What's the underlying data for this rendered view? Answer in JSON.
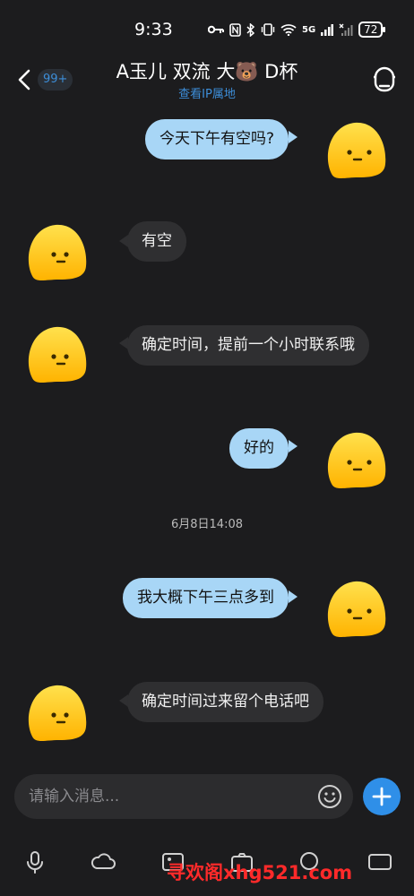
{
  "status_bar": {
    "time": "9:33",
    "network": "5G",
    "battery": "72"
  },
  "header": {
    "unread_count": "99+",
    "title": "A玉儿 双流 大🐻 D杯",
    "subtitle": "查看IP属地"
  },
  "messages": [
    {
      "side": "me",
      "text": "今天下午有空吗?"
    },
    {
      "side": "them",
      "text": "有空"
    },
    {
      "side": "them",
      "text": "确定时间，提前一个小时联系哦"
    },
    {
      "side": "me",
      "text": "好的"
    },
    {
      "side": "me",
      "text": "我大概下午三点多到"
    },
    {
      "side": "them",
      "text": "确定时间过来留个电话吧"
    }
  ],
  "timestamp": "6月8日14:08",
  "composer": {
    "placeholder": "请输入消息..."
  },
  "toolbar": {
    "icons": [
      "mic-icon",
      "cloud-icon",
      "image-icon",
      "camera-icon",
      "search-icon",
      "gif-icon"
    ]
  },
  "watermark": "寻欢阁xhg521.com",
  "colors": {
    "background": "#1c1c1e",
    "my_bubble": "#a8d6f6",
    "their_bubble": "#2f2f31",
    "accent": "#3d8ed9",
    "plus_button": "#2f8fe8",
    "avatar": "#ffc21a",
    "watermark": "#ff2a2a"
  }
}
